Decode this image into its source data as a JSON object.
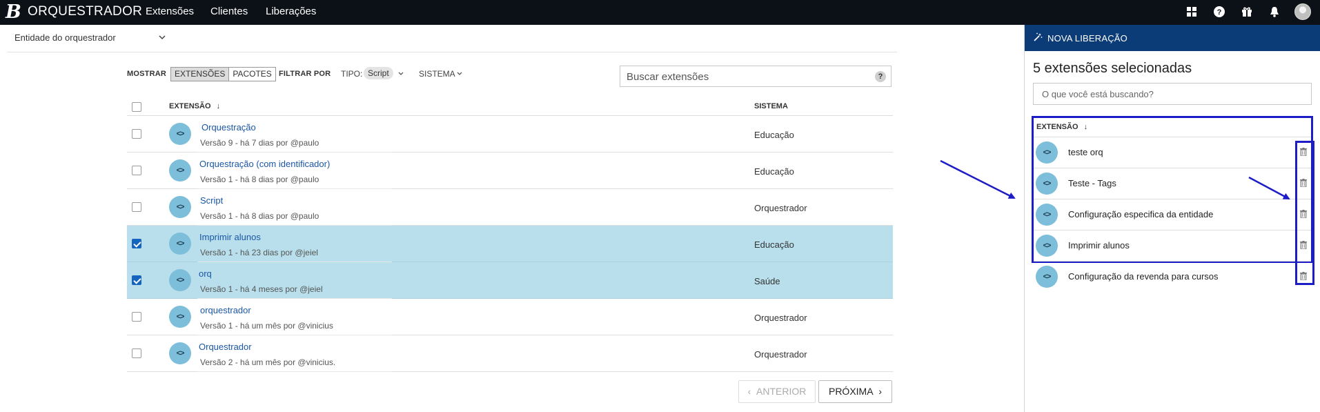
{
  "topbar": {
    "logo": "B",
    "brand": "ORQUESTRADOR",
    "nav": [
      "Extensões",
      "Clientes",
      "Liberações"
    ],
    "icons": [
      "apps-grid-icon",
      "help-icon",
      "gift-icon",
      "bell-icon",
      "avatar"
    ]
  },
  "entity_select": {
    "value": "Entidade do orquestrador"
  },
  "filters": {
    "show_label": "MOSTRAR",
    "show_options": [
      "EXTENSÕES",
      "PACOTES"
    ],
    "show_selected": "EXTENSÕES",
    "filter_label": "FILTRAR POR",
    "type_label": "TIPO:",
    "type_value": "Script",
    "system_label": "SISTEMA"
  },
  "search": {
    "placeholder": "Buscar extensões",
    "help": "?"
  },
  "table": {
    "columns": {
      "extension": "EXTENSÃO",
      "system": "SISTEMA"
    },
    "rows": [
      {
        "name": "Orquestração",
        "meta": "Versão 9 - há 7 dias por @paulo",
        "system": "Educação",
        "checked": false
      },
      {
        "name": "Orquestração (com identificador)",
        "meta": "Versão 1 - há 8 dias por @paulo",
        "system": "Educação",
        "checked": false
      },
      {
        "name": "Script",
        "meta": "Versão 1 - há 8 dias por @paulo",
        "system": "Orquestrador",
        "checked": false
      },
      {
        "name": "Imprimir alunos",
        "meta": "Versão 1 - há 23 dias por @jeiel",
        "system": "Educação",
        "checked": true
      },
      {
        "name": "orq",
        "meta": "Versão 1 - há 4 meses por @jeiel",
        "system": "Saúde",
        "checked": true
      },
      {
        "name": "orquestrador",
        "meta": "Versão 1 - há um mês por @vinicius",
        "system": "Orquestrador",
        "checked": false
      },
      {
        "name": "Orquestrador",
        "meta": "Versão 2 - há um mês por @vinicius.",
        "system": "Orquestrador",
        "checked": false
      }
    ]
  },
  "pagination": {
    "prev": "ANTERIOR",
    "next": "PRÓXIMA"
  },
  "panel": {
    "header": "NOVA LIBERAÇÃO",
    "title": "5 extensões selecionadas",
    "search_placeholder": "O que você está buscando?",
    "column": "EXTENSÃO",
    "items": [
      {
        "name": "teste orq"
      },
      {
        "name": "Teste - Tags"
      },
      {
        "name": "Configuração especifica da entidade"
      },
      {
        "name": "Imprimir alunos"
      },
      {
        "name": "Configuração da revenda para cursos"
      }
    ]
  },
  "colors": {
    "topbar": "#0c1117",
    "panel_header": "#0b3c77",
    "selected_row": "#b8dfeb",
    "link": "#1a56a6",
    "annotation": "#1d1dc8",
    "icon_circle": "#7dbfda"
  }
}
